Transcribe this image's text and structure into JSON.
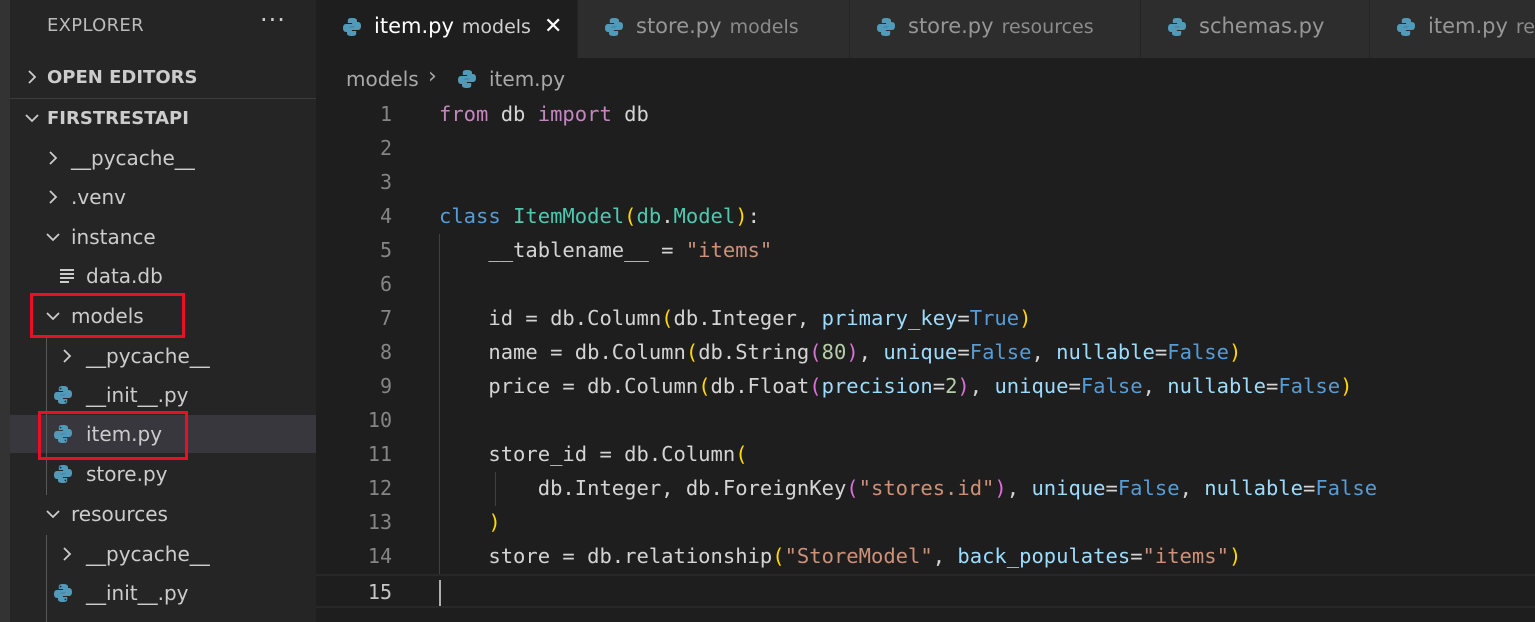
{
  "sidebar": {
    "header": "EXPLORER",
    "more": "···",
    "sections": [
      {
        "label": "OPEN EDITORS"
      },
      {
        "label": "FIRSTRESTAPI"
      }
    ],
    "tree": [
      {
        "label": "__pycache__"
      },
      {
        "label": ".venv"
      },
      {
        "label": "instance"
      },
      {
        "label": "data.db"
      },
      {
        "label": "models"
      },
      {
        "label": "__pycache__"
      },
      {
        "label": "__init__.py"
      },
      {
        "label": "item.py"
      },
      {
        "label": "store.py"
      },
      {
        "label": "resources"
      },
      {
        "label": "__pycache__"
      },
      {
        "label": "__init__.py"
      }
    ]
  },
  "tabs": [
    {
      "name": "item.py",
      "desc": "models",
      "active": true,
      "close": "✕"
    },
    {
      "name": "store.py",
      "desc": "models"
    },
    {
      "name": "store.py",
      "desc": "resources"
    },
    {
      "name": "schemas.py",
      "desc": ""
    },
    {
      "name": "item.py",
      "desc": "res"
    }
  ],
  "breadcrumb": {
    "folder": "models",
    "sep": "›",
    "file": "item.py"
  },
  "editor": {
    "line_numbers": [
      "1",
      "2",
      "3",
      "4",
      "5",
      "6",
      "7",
      "8",
      "9",
      "10",
      "11",
      "12",
      "13",
      "14",
      "15"
    ],
    "active_line": "15"
  },
  "colors": {
    "keyword": "#c586c0",
    "keyword_blue": "#569cd6",
    "class": "#4ec9b0",
    "function": "#dcdcaa",
    "variable": "#9cdcfe",
    "string": "#ce9178",
    "number": "#b5cea8",
    "bracket1": "#ffd700",
    "bracket2": "#da70d6",
    "highlight": "#e81123"
  }
}
